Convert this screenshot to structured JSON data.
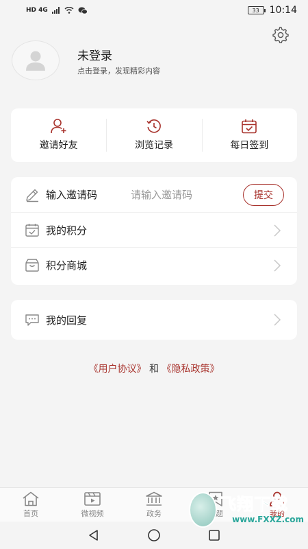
{
  "status_bar": {
    "network": "HD 4G",
    "battery": "33",
    "time": "10:14"
  },
  "profile": {
    "name": "未登录",
    "hint": "点击登录，发现精彩内容"
  },
  "quick_actions": [
    {
      "label": "邀请好友",
      "icon": "add-user-icon"
    },
    {
      "label": "浏览记录",
      "icon": "history-icon"
    },
    {
      "label": "每日签到",
      "icon": "calendar-check-icon"
    }
  ],
  "invite": {
    "label": "输入邀请码",
    "placeholder": "请输入邀请码",
    "value": "",
    "submit": "提交"
  },
  "menu": {
    "points": "我的积分",
    "mall": "积分商城",
    "replies": "我的回复"
  },
  "agreement": {
    "user_agreement": "《用户协议》",
    "and": "和",
    "privacy_policy": "《隐私政策》"
  },
  "tabs": [
    {
      "label": "首页",
      "icon": "home-icon"
    },
    {
      "label": "微视频",
      "icon": "video-icon"
    },
    {
      "label": "政务",
      "icon": "government-icon"
    },
    {
      "label": "专题",
      "icon": "bookmark-star-icon"
    },
    {
      "label": "我的",
      "icon": "profile-icon",
      "active": true
    }
  ],
  "watermark": {
    "title": "飞翔下载",
    "url": "www.FXXZ.com"
  },
  "colors": {
    "accent": "#a8322c",
    "background": "#f4f4f4",
    "card": "#ffffff",
    "icon_gray": "#888888"
  }
}
